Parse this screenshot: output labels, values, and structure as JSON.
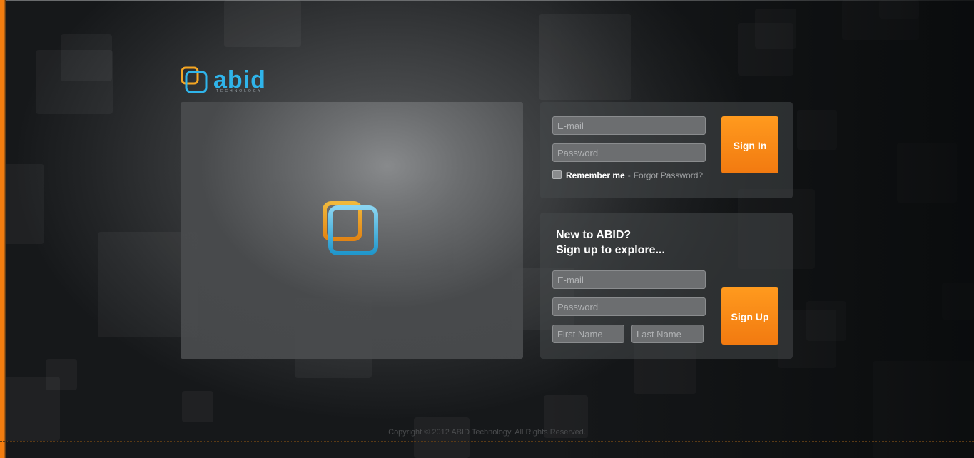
{
  "brand": {
    "name": "abid",
    "tagline": "TECHNOLOGY",
    "colors": {
      "accent": "#f27d10",
      "logo_blue": "#2fb4ea",
      "logo_orange": "#f5a623"
    }
  },
  "signin": {
    "email_placeholder": "E-mail",
    "password_placeholder": "Password",
    "remember_label": "Remember me",
    "separator": "-",
    "forgot_label": "Forgot Password?",
    "button_label": "Sign In"
  },
  "signup": {
    "title_line1": "New to ABID?",
    "title_line2": "Sign up to explore...",
    "email_placeholder": "E-mail",
    "password_placeholder": "Password",
    "first_name_placeholder": "First Name",
    "last_name_placeholder": "Last Name",
    "button_label": "Sign Up"
  },
  "footer": {
    "copyright": "Copyright © 2012 ABID Technology. All Rights Reserved."
  }
}
